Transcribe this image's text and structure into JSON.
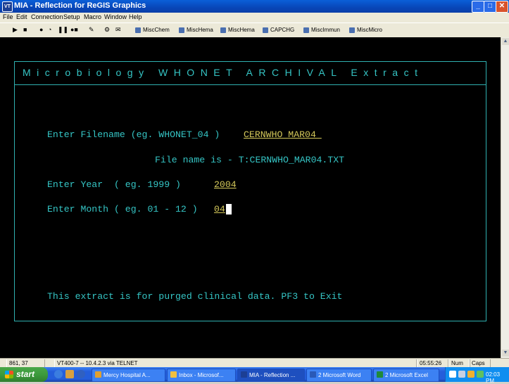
{
  "window": {
    "title": "MIA - Reflection for ReGIS Graphics",
    "icon_text": "VT",
    "buttons": {
      "minimize": "_",
      "maximize": "□",
      "close": "✕"
    }
  },
  "menu": [
    "File",
    "Edit",
    "Connection",
    "Setup",
    "Macro",
    "Window",
    "Help"
  ],
  "toolbar": {
    "buttons": [
      "MiscChem",
      "MiscHema",
      "MiscHema",
      "CAPCHG",
      "MiscImmun",
      "MiscMicro"
    ]
  },
  "terminal": {
    "heading": "Microbiology WHONET ARCHIVAL Extract",
    "filename_label": "Enter Filename (eg. WHONET_04 )",
    "filename_value": "CERNWHO_MAR04 ",
    "file_name_line": "File name is - T:CERNWHO_MAR04.TXT",
    "year_label": "Enter Year  ( eg. 1999 )",
    "year_value": "2004",
    "month_label": "Enter Month ( eg. 01 - 12 )",
    "month_value": "04",
    "footer": "This extract is for purged clinical data. PF3 to Exit"
  },
  "status": {
    "cursor_pos": "861, 37",
    "connection": "VT400-7 -- 10.4.2.3 via TELNET",
    "time": "05:55:26",
    "num": "Num",
    "caps": "Caps"
  },
  "taskbar": {
    "start": "start",
    "tasks": [
      {
        "label": "Mercy Hospital A...",
        "color": "#e0a030"
      },
      {
        "label": "Inbox - Microsof...",
        "color": "#f0c040"
      },
      {
        "label": "MIA - Reflection ...",
        "color": "#1c3f94"
      },
      {
        "label": "2 Microsoft Word",
        "color": "#2a5ab8"
      },
      {
        "label": "2 Microsoft Excel",
        "color": "#1f8a3a"
      }
    ],
    "clock": "02:03 PM"
  }
}
